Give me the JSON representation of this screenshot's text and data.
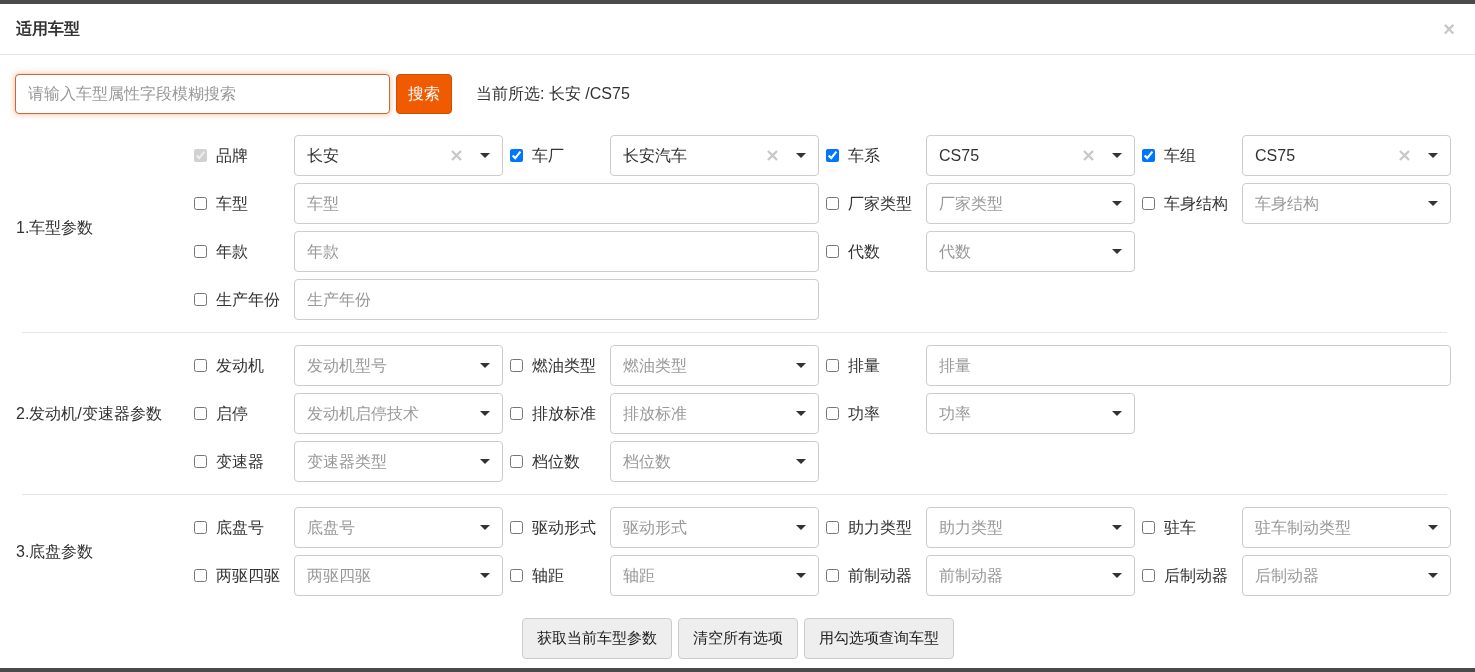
{
  "dialog": {
    "title": "适用车型",
    "close": "×"
  },
  "search": {
    "placeholder": "请输入车型属性字段模糊搜索",
    "button": "搜索",
    "current_label": "当前所选: 长安 /CS75"
  },
  "sections": [
    {
      "title": "1.车型参数",
      "rows": [
        [
          {
            "label": "品牌",
            "checked": true,
            "disabled": true,
            "kind": "select",
            "value": "长安",
            "clearable": true
          },
          {
            "label": "车厂",
            "checked": true,
            "disabled": false,
            "kind": "select",
            "value": "长安汽车",
            "clearable": true
          },
          {
            "label": "车系",
            "checked": true,
            "disabled": false,
            "kind": "select",
            "value": "CS75",
            "clearable": true
          },
          {
            "label": "车组",
            "checked": true,
            "disabled": false,
            "kind": "select",
            "value": "CS75",
            "clearable": true
          }
        ],
        [
          {
            "label": "车型",
            "checked": false,
            "disabled": false,
            "kind": "wide-text",
            "placeholder": "车型"
          },
          "",
          {
            "label": "厂家类型",
            "checked": false,
            "disabled": false,
            "kind": "select",
            "placeholder": "厂家类型"
          },
          {
            "label": "车身结构",
            "checked": false,
            "disabled": false,
            "kind": "select",
            "placeholder": "车身结构"
          }
        ],
        [
          {
            "label": "年款",
            "checked": false,
            "disabled": false,
            "kind": "wide-text",
            "placeholder": "年款"
          },
          "",
          {
            "label": "代数",
            "checked": false,
            "disabled": false,
            "kind": "select",
            "placeholder": "代数"
          }
        ],
        [
          {
            "label": "生产年份",
            "checked": false,
            "disabled": false,
            "kind": "wide-text",
            "placeholder": "生产年份"
          }
        ]
      ]
    },
    {
      "title": "2.发动机/变速器参数",
      "rows": [
        [
          {
            "label": "发动机",
            "checked": false,
            "disabled": false,
            "kind": "select",
            "placeholder": "发动机型号"
          },
          {
            "label": "燃油类型",
            "checked": false,
            "disabled": false,
            "kind": "select",
            "placeholder": "燃油类型"
          },
          {
            "label": "排量",
            "checked": false,
            "disabled": false,
            "kind": "wide-text",
            "placeholder": "排量"
          }
        ],
        [
          {
            "label": "启停",
            "checked": false,
            "disabled": false,
            "kind": "select",
            "placeholder": "发动机启停技术"
          },
          {
            "label": "排放标准",
            "checked": false,
            "disabled": false,
            "kind": "select",
            "placeholder": "排放标准"
          },
          {
            "label": "功率",
            "checked": false,
            "disabled": false,
            "kind": "select",
            "placeholder": "功率"
          }
        ],
        [
          {
            "label": "变速器",
            "checked": false,
            "disabled": false,
            "kind": "select",
            "placeholder": "变速器类型"
          },
          {
            "label": "档位数",
            "checked": false,
            "disabled": false,
            "kind": "select",
            "placeholder": "档位数"
          }
        ]
      ]
    },
    {
      "title": "3.底盘参数",
      "rows": [
        [
          {
            "label": "底盘号",
            "checked": false,
            "disabled": false,
            "kind": "select",
            "placeholder": "底盘号"
          },
          {
            "label": "驱动形式",
            "checked": false,
            "disabled": false,
            "kind": "select",
            "placeholder": "驱动形式"
          },
          {
            "label": "助力类型",
            "checked": false,
            "disabled": false,
            "kind": "select",
            "placeholder": "助力类型"
          },
          {
            "label": "驻车",
            "checked": false,
            "disabled": false,
            "kind": "select",
            "placeholder": "驻车制动类型"
          }
        ],
        [
          {
            "label": "两驱四驱",
            "checked": false,
            "disabled": false,
            "kind": "select",
            "placeholder": "两驱四驱"
          },
          {
            "label": "轴距",
            "checked": false,
            "disabled": false,
            "kind": "select",
            "placeholder": "轴距"
          },
          {
            "label": "前制动器",
            "checked": false,
            "disabled": false,
            "kind": "select",
            "placeholder": "前制动器"
          },
          {
            "label": "后制动器",
            "checked": false,
            "disabled": false,
            "kind": "select",
            "placeholder": "后制动器"
          }
        ]
      ]
    }
  ],
  "buttons": [
    "获取当前车型参数",
    "清空所有选项",
    "用勾选项查询车型"
  ]
}
